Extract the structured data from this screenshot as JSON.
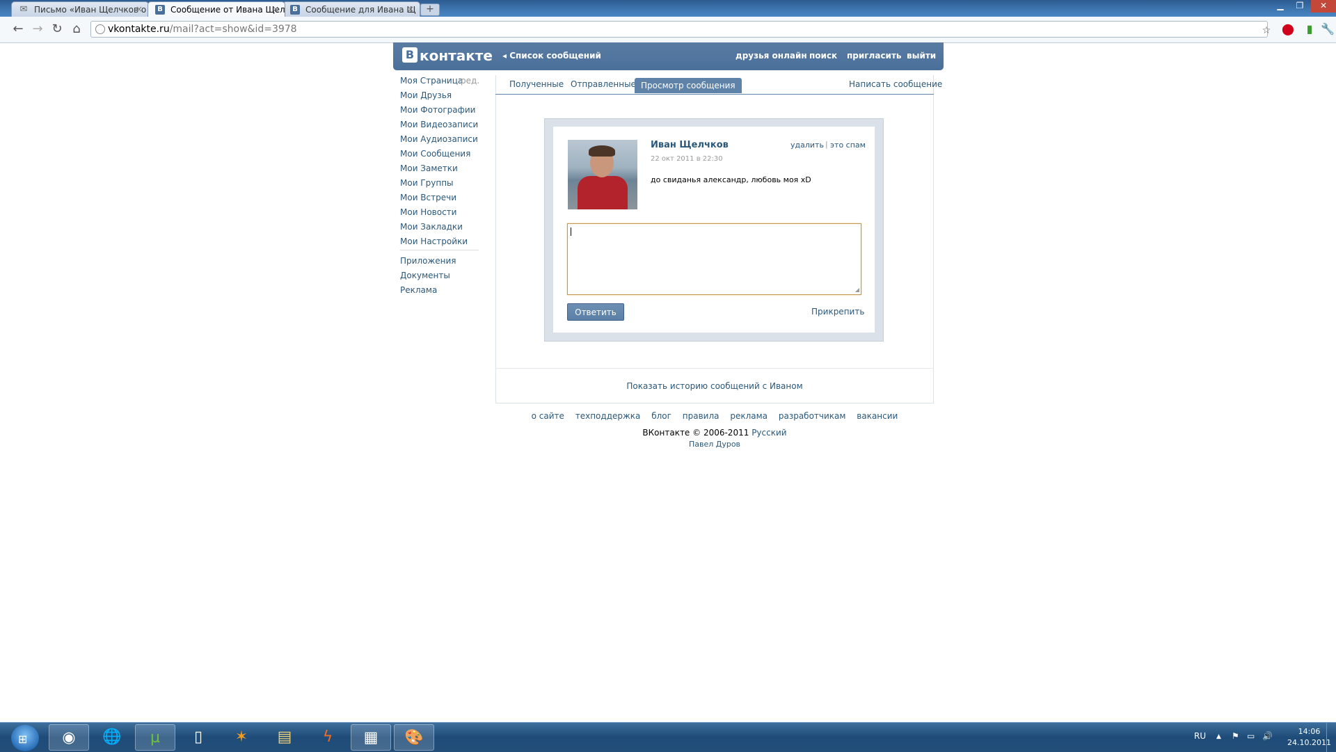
{
  "browser": {
    "tabs": [
      {
        "icon": "mail-icon",
        "title": "Письмо «Иван Щелчков о"
      },
      {
        "icon": "vk-icon",
        "title": "Сообщение от Ивана Щел"
      },
      {
        "icon": "vk-icon",
        "title": "Сообщение для Ивана Щ"
      }
    ],
    "url_host": "vkontakte.ru",
    "url_path": "/mail?act=show&id=3978"
  },
  "vk": {
    "logo": "контакте",
    "back_link": "Список сообщений",
    "top_nav": [
      "друзья онлайн",
      "поиск",
      "пригласить",
      "выйти"
    ],
    "left_nav": {
      "my_page": "Моя Страница",
      "edit": "ред.",
      "items": [
        "Мои Друзья",
        "Мои Фотографии",
        "Мои Видеозаписи",
        "Мои Аудиозаписи",
        "Мои Сообщения",
        "Мои Заметки",
        "Мои Группы",
        "Мои Встречи",
        "Мои Новости",
        "Мои Закладки",
        "Мои Настройки"
      ],
      "extra": [
        "Приложения",
        "Документы",
        "Реклама"
      ]
    },
    "tabs": {
      "received": "Полученные",
      "sent": "Отправленные",
      "view": "Просмотр сообщения",
      "compose": "Написать сообщение"
    },
    "message": {
      "sender": "Иван Щелчков",
      "date": "22 окт 2011 в 22:30",
      "text": "до свиданья александр, любовь моя xD",
      "delete": "удалить",
      "separator": "|",
      "spam": "это спам",
      "reply_value": "",
      "reply_button": "Ответить",
      "attach": "Прикрепить"
    },
    "history_link": "Показать историю сообщений с Иваном",
    "footer": {
      "links": [
        "о сайте",
        "техподдержка",
        "блог",
        "правила",
        "реклама",
        "разработчикам",
        "вакансии"
      ],
      "copyright": "ВКонтакте © 2006-2011",
      "language": "Русский",
      "author": "Павел Дуров"
    },
    "colors": {
      "header": "#4a6f9b",
      "link": "#2b587a",
      "accent": "#5e82a8"
    }
  },
  "taskbar": {
    "apps": [
      "chrome-icon",
      "network-icon",
      "utorrent-icon",
      "document-icon",
      "avast-icon",
      "folder-icon",
      "flash-icon",
      "remote-desktop-icon",
      "paint-icon"
    ],
    "language": "RU",
    "time": "14:06",
    "date": "24.10.2011"
  }
}
